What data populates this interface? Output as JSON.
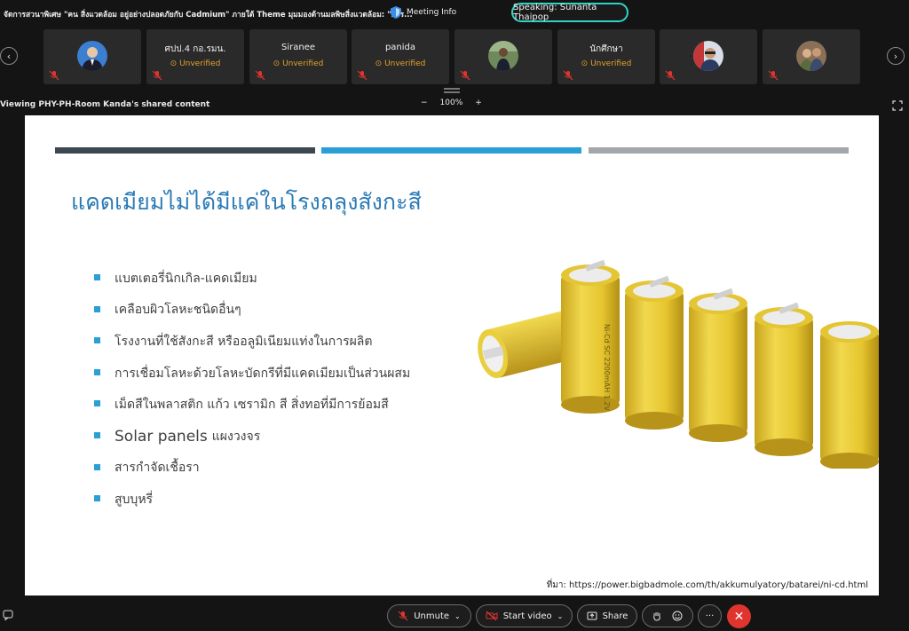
{
  "meeting": {
    "title": "จัดการสวนาพิเศษ \"คน สิ่งแวดล้อม อยู่อย่างปลอดภัยกับ Cadmium\" ภายใต้ Theme มุมมองด้านมลพิษสิ่งแวดล้อม: \"การ...",
    "info_label": "Meeting Info",
    "speaking": "Speaking: Sunanta Thaipop"
  },
  "participants": [
    {
      "name": "",
      "unverified": "",
      "avatar": "man-suit"
    },
    {
      "name": "ศปป.4 กอ.รมน.",
      "unverified": "Unverified"
    },
    {
      "name": "Siranee",
      "unverified": "Unverified"
    },
    {
      "name": "panida",
      "unverified": "Unverified"
    },
    {
      "name": "",
      "unverified": "",
      "avatar": "person-outdoor"
    },
    {
      "name": "นักศึกษา",
      "unverified": "Unverified"
    },
    {
      "name": "",
      "unverified": "",
      "avatar": "man-glasses"
    },
    {
      "name": "",
      "unverified": "",
      "avatar": "group-photo"
    }
  ],
  "share": {
    "viewing": "Viewing PHY-PH-Room Kanda's shared content",
    "zoom_out": "−",
    "zoom_level": "100%",
    "zoom_in": "+"
  },
  "slide": {
    "title": "แคดเมียมไม่ได้มีแค่ในโรงถลุงสังกะสี",
    "bullets": [
      "แบตเตอรี่นิกเกิล-แคดเมียม",
      "เคลือบผิวโลหะชนิดอื่นๆ",
      "โรงงานที่ใช้สังกะสี หรืออลูมิเนียมแท่งในการผลิต",
      "การเชื่อมโลหะด้วยโลหะบัดกรีที่มีแคดเมียมเป็นส่วนผสม",
      "เม็ดสีในพลาสติก แก้ว เซรามิก สี สิ่งทอที่มีการย้อมสี"
    ],
    "bullet_solar_main": "Solar panels",
    "bullet_solar_sub": "แผงวงจร",
    "bullets_tail": [
      "สารกำจัดเชื้อรา",
      "สูบบุหรี่"
    ],
    "battery_label": "Ni-Cd SC 2200mAH 1.2V",
    "source": "ที่มา: https://power.bigbadmole.com/th/akkumulyatory/batarei/ni-cd.html"
  },
  "controls": {
    "unmute": "Unmute",
    "start_video": "Start video",
    "share": "Share",
    "more": "···",
    "leave": "✕"
  },
  "colors": {
    "accent": "#2a9fd6",
    "title_blue": "#2b7bb6",
    "unverified": "#e5a32b",
    "speaking_border": "#2fd3c4",
    "leave_red": "#e0352f",
    "battery_yellow": "#e6c62f"
  }
}
